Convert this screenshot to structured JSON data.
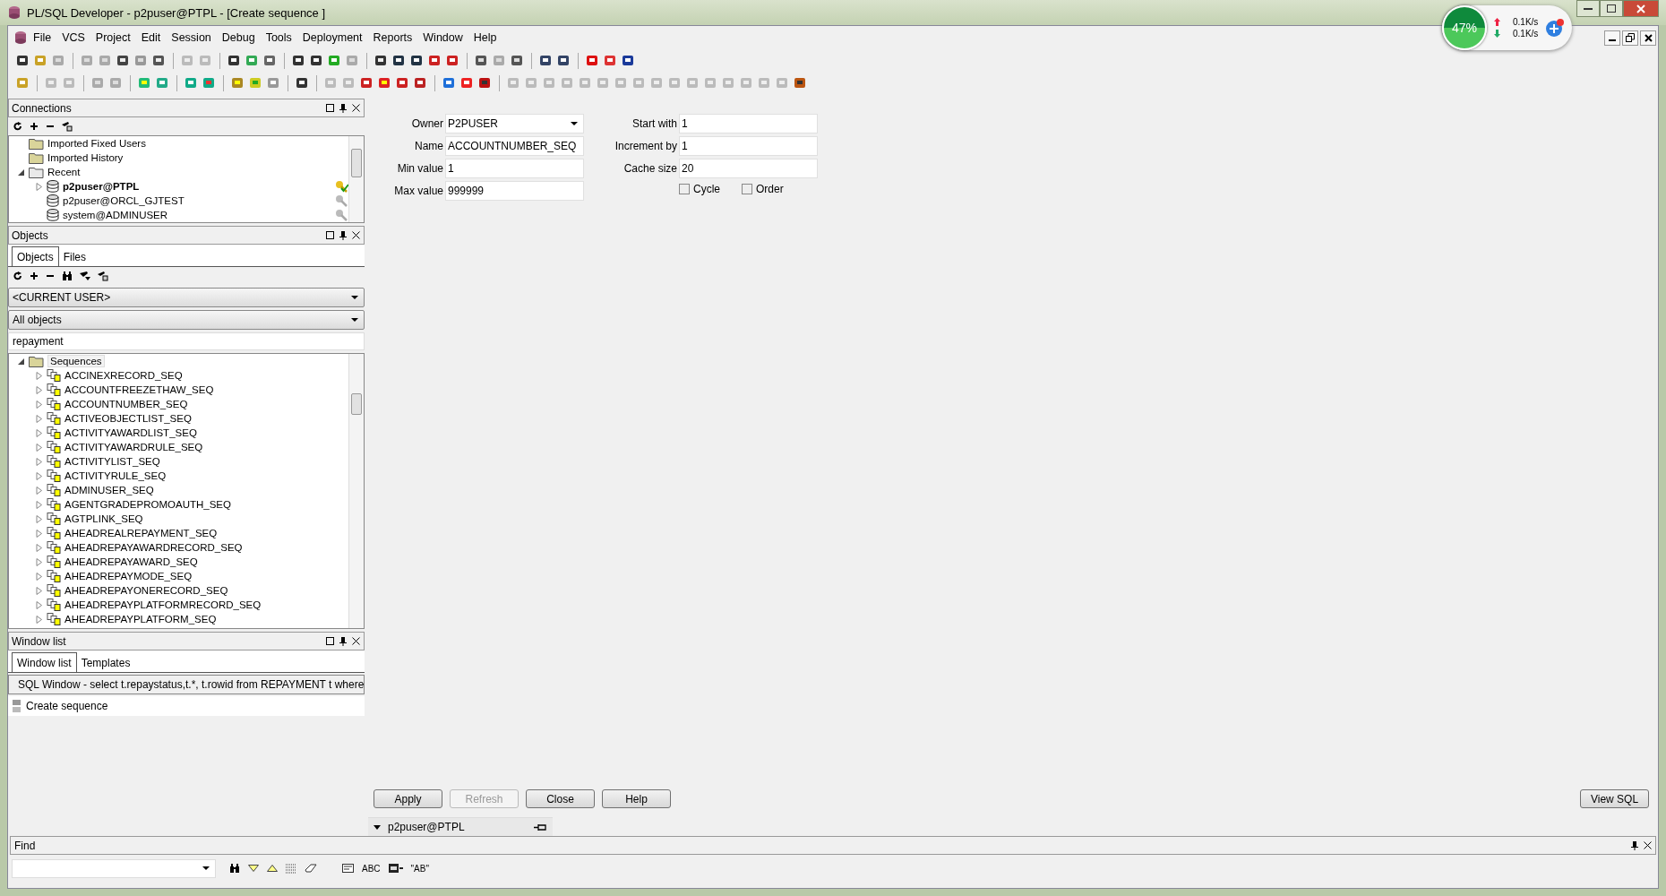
{
  "window": {
    "title": "PL/SQL Developer - p2puser@PTPL - [Create sequence ]"
  },
  "net_monitor": {
    "percent": "47%",
    "upload": "0.1K/s",
    "download": "0.1K/s"
  },
  "menu": [
    "File",
    "VCS",
    "Project",
    "Edit",
    "Session",
    "Debug",
    "Tools",
    "Deployment",
    "Reports",
    "Window",
    "Help"
  ],
  "connections": {
    "title": "Connections",
    "tree": [
      {
        "label": "Imported Fixed Users",
        "kind": "folder"
      },
      {
        "label": "Imported History",
        "kind": "folder"
      },
      {
        "label": "Recent",
        "kind": "group",
        "expanded": true,
        "children": [
          {
            "label": "p2puser@PTPL",
            "active": true
          },
          {
            "label": "p2puser@ORCL_GJTEST",
            "active": false
          },
          {
            "label": "system@ADMINUSER",
            "active": false
          }
        ]
      }
    ]
  },
  "objects": {
    "title": "Objects",
    "tabs": [
      {
        "label": "Objects",
        "selected": true
      },
      {
        "label": "Files",
        "selected": false
      }
    ],
    "user_filter": "<CURRENT USER>",
    "type_filter": "All objects",
    "search": "repayment",
    "tree": [
      {
        "label": "Sequences",
        "expanded": true,
        "children": [
          {
            "label": "ACCINEXRECORD_SEQ",
            "expanded": false
          },
          {
            "label": "ACCOUNTFREEZETHAW_SEQ",
            "expanded": false
          },
          {
            "label": "ACCOUNTNUMBER_SEQ",
            "expanded": false
          },
          {
            "label": "ACTIVEOBJECTLIST_SEQ",
            "expanded": false
          },
          {
            "label": "ACTIVITYAWARDLIST_SEQ",
            "expanded": false
          },
          {
            "label": "ACTIVITYAWARDRULE_SEQ",
            "expanded": false
          },
          {
            "label": "ACTIVITYLIST_SEQ",
            "expanded": false
          },
          {
            "label": "ACTIVITYRULE_SEQ",
            "expanded": false
          },
          {
            "label": "ADMINUSER_SEQ",
            "expanded": false
          },
          {
            "label": "AGENTGRADEPROMOAUTH_SEQ",
            "expanded": false
          },
          {
            "label": "AGTPLINK_SEQ",
            "expanded": false
          },
          {
            "label": "AHEADREALREPAYMENT_SEQ",
            "expanded": false
          },
          {
            "label": "AHEADREPAYAWARDRECORD_SEQ",
            "expanded": false
          },
          {
            "label": "AHEADREPAYAWARD_SEQ",
            "expanded": false
          },
          {
            "label": "AHEADREPAYMODE_SEQ",
            "expanded": false
          },
          {
            "label": "AHEADREPAYONERECORD_SEQ",
            "expanded": false
          },
          {
            "label": "AHEADREPAYPLATFORMRECORD_SEQ",
            "expanded": false
          },
          {
            "label": "AHEADREPAYPLATFORM_SEQ",
            "expanded": false
          }
        ]
      }
    ]
  },
  "window_list": {
    "title": "Window list",
    "tabs": [
      {
        "label": "Window list",
        "selected": true
      },
      {
        "label": "Templates",
        "selected": false
      }
    ],
    "items": [
      {
        "label": "SQL Window - select t.repaystatus,t.*, t.rowid from REPAYMENT t where",
        "kind": "sql",
        "selected": true
      },
      {
        "label": "Create sequence",
        "kind": "form",
        "selected": false
      }
    ]
  },
  "form": {
    "left": [
      {
        "label": "Owner",
        "value": "P2PUSER",
        "kind": "dropdown"
      },
      {
        "label": "Name",
        "value": "ACCOUNTNUMBER_SEQ",
        "kind": "text"
      },
      {
        "label": "Min value",
        "value": "1",
        "kind": "text"
      },
      {
        "label": "Max value",
        "value": "999999",
        "kind": "text"
      }
    ],
    "right": [
      {
        "label": "Start with",
        "value": "1"
      },
      {
        "label": "Increment by",
        "value": "1"
      },
      {
        "label": "Cache size",
        "value": "20"
      }
    ],
    "checkboxes": [
      {
        "label": "Cycle",
        "checked": false
      },
      {
        "label": "Order",
        "checked": false
      }
    ]
  },
  "buttons": [
    {
      "label": "Apply",
      "disabled": false
    },
    {
      "label": "Refresh",
      "disabled": true
    },
    {
      "label": "Close",
      "disabled": false
    },
    {
      "label": "Help",
      "disabled": false
    }
  ],
  "view_sql": "View SQL",
  "connection_bar": "p2puser@PTPL",
  "find": {
    "title": "Find",
    "options": [
      "ABC",
      "\"AB\""
    ]
  }
}
